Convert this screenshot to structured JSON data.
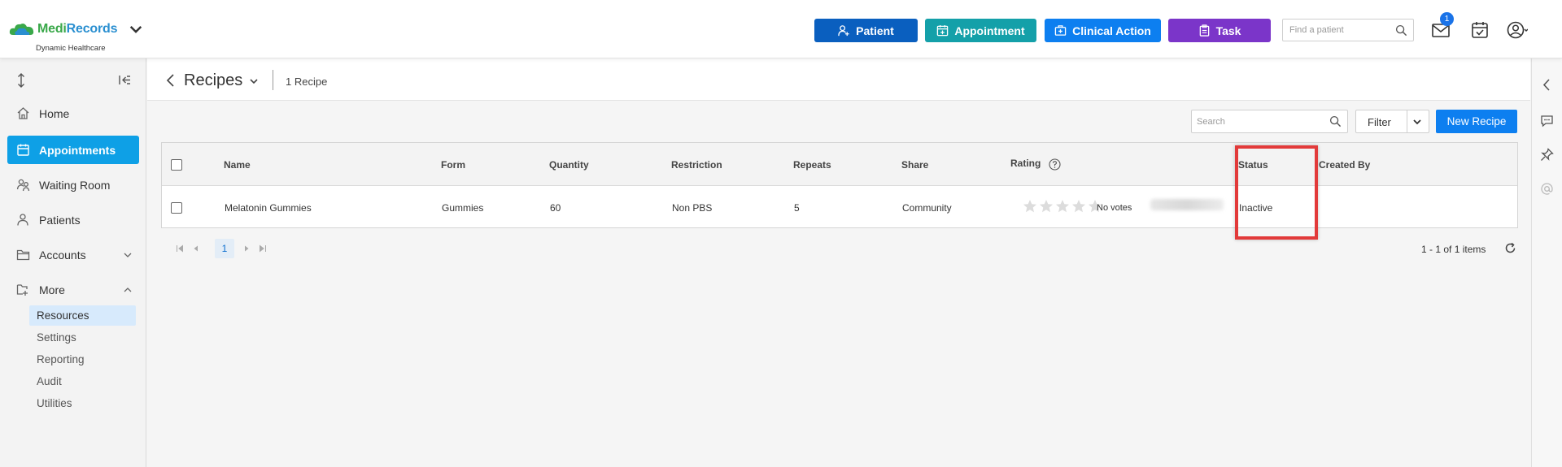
{
  "brand": {
    "logo_part1": "Medi",
    "logo_part2": "Records",
    "org_name": "Dynamic Healthcare"
  },
  "header": {
    "buttons": {
      "patient": "Patient",
      "appointment": "Appointment",
      "clinical_action": "Clinical Action",
      "task": "Task"
    },
    "find_patient_placeholder": "Find a patient",
    "inbox_badge": "1",
    "colors": {
      "patient": "#0a5fbf",
      "appointment": "#14a0a9",
      "clinical_action": "#0d7ff0",
      "task": "#7b35c9"
    }
  },
  "sidebar": {
    "items": [
      {
        "label": "Home",
        "icon": "home-icon"
      },
      {
        "label": "Appointments",
        "icon": "calendar-icon",
        "active": true
      },
      {
        "label": "Waiting Room",
        "icon": "people-icon"
      },
      {
        "label": "Patients",
        "icon": "person-icon"
      },
      {
        "label": "Accounts",
        "icon": "folder-icon",
        "expandable": true
      },
      {
        "label": "More",
        "icon": "folder-tree-icon",
        "expanded": true
      }
    ],
    "subitems": [
      "Resources",
      "Settings",
      "Reporting",
      "Audit",
      "Utilities"
    ],
    "active_subitem": "Resources"
  },
  "page": {
    "title": "Recipes",
    "count": "1 Recipe"
  },
  "toolbar": {
    "search_placeholder": "Search",
    "filter_label": "Filter",
    "new_label": "New Recipe"
  },
  "table": {
    "columns": [
      "Name",
      "Form",
      "Quantity",
      "Restriction",
      "Repeats",
      "Share",
      "Rating",
      "Status",
      "Created By"
    ],
    "rows": [
      {
        "name": "Melatonin Gummies",
        "form": "Gummies",
        "quantity": "60",
        "restriction": "Non PBS",
        "repeats": "5",
        "share": "Community",
        "rating_stars": 0,
        "rating_text": "No votes",
        "status": "Inactive"
      }
    ]
  },
  "pager": {
    "current_page": "1",
    "info": "1 - 1 of 1 items"
  }
}
